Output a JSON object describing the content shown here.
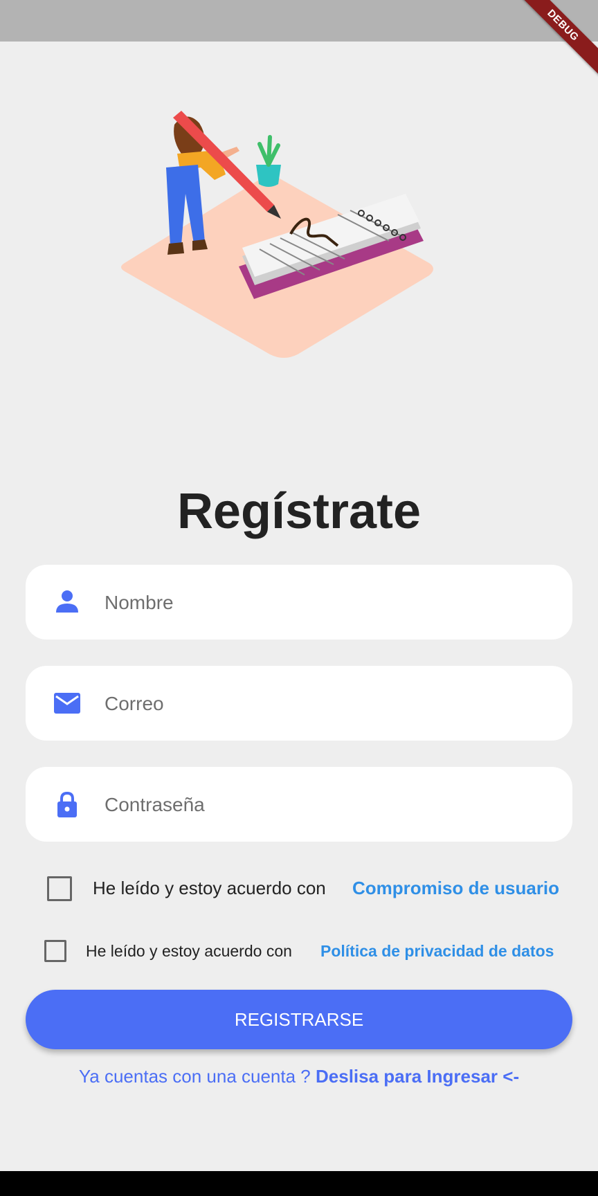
{
  "debug_banner": "DEBUG",
  "title": "Regístrate",
  "fields": {
    "name": {
      "placeholder": "Nombre",
      "icon": "person-icon"
    },
    "email": {
      "placeholder": "Correo",
      "icon": "mail-icon"
    },
    "password": {
      "placeholder": "Contraseña",
      "icon": "lock-icon"
    }
  },
  "consents": [
    {
      "text": "He leído y estoy acuerdo con",
      "link": "Compromiso de usuario",
      "checked": false
    },
    {
      "text": "He leído y estoy acuerdo con",
      "link": "Política de privacidad de datos",
      "checked": false
    }
  ],
  "register_button": "REGISTRARSE",
  "login_prompt": {
    "text": "Ya cuentas con una cuenta ?",
    "link": "Deslisa para Ingresar <-"
  },
  "colors": {
    "primary": "#4b6ef5",
    "link": "#2f8fe6",
    "background": "#eeeeee"
  }
}
